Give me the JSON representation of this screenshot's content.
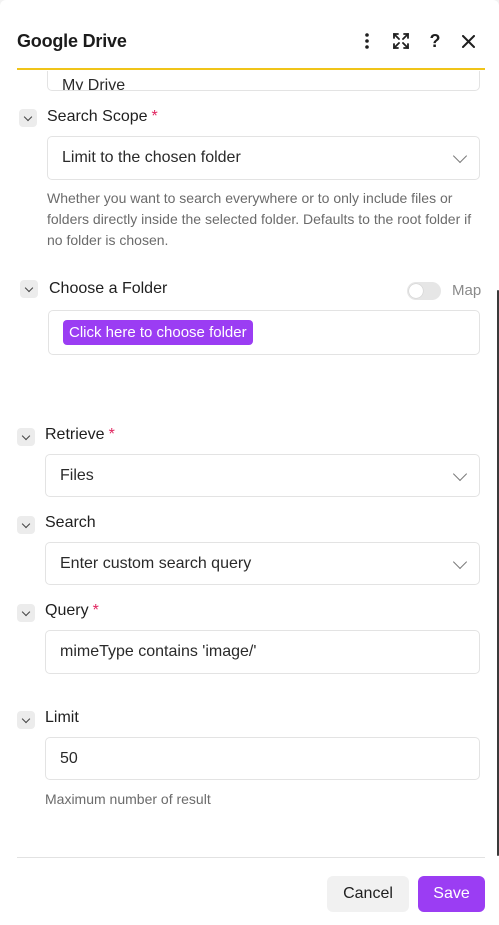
{
  "header": {
    "title": "Google Drive",
    "accent_color": "#f0c419"
  },
  "drive_field": {
    "value": "My Drive"
  },
  "search_scope": {
    "label": "Search Scope",
    "required_mark": "*",
    "value": "Limit to the chosen folder",
    "help": "Whether you want to search everywhere or to only include files or folders directly inside the selected folder. Defaults to the root folder if no folder is chosen."
  },
  "choose_folder": {
    "label": "Choose a Folder",
    "map_label": "Map",
    "map_enabled": false,
    "button_label": "Click here to choose folder",
    "button_color": "#9b3df3"
  },
  "retrieve": {
    "label": "Retrieve",
    "required_mark": "*",
    "value": "Files"
  },
  "search": {
    "label": "Search",
    "value": "Enter custom search query"
  },
  "query": {
    "label": "Query",
    "required_mark": "*",
    "value": "mimeType contains 'image/'"
  },
  "limit": {
    "label": "Limit",
    "value": "50",
    "help": "Maximum number of result"
  },
  "footer": {
    "cancel_label": "Cancel",
    "save_label": "Save",
    "save_color": "#9b3df3"
  }
}
